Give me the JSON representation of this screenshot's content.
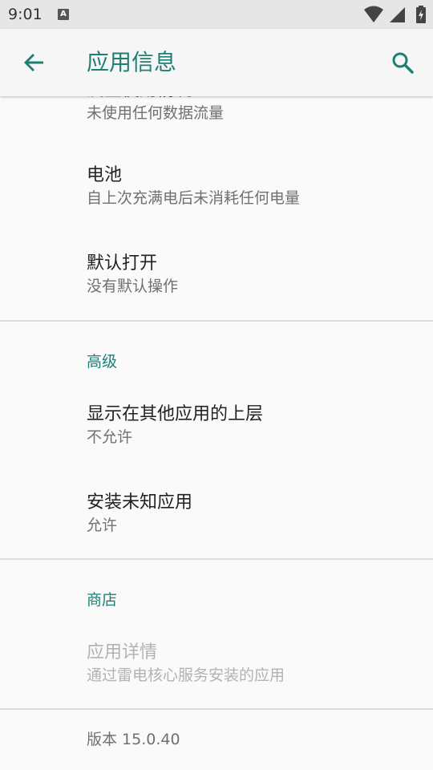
{
  "status_bar": {
    "time": "9:01",
    "notification_letter": "A"
  },
  "app_bar": {
    "title": "应用信息"
  },
  "items": {
    "data_usage": {
      "title": "流量使用情况",
      "subtitle": "未使用任何数据流量"
    },
    "battery": {
      "title": "电池",
      "subtitle": "自上次充满电后未消耗任何电量"
    },
    "open_by_default": {
      "title": "默认打开",
      "subtitle": "没有默认操作"
    },
    "advanced_header": "高级",
    "display_over": {
      "title": "显示在其他应用的上层",
      "subtitle": "不允许"
    },
    "install_unknown": {
      "title": "安装未知应用",
      "subtitle": "允许"
    },
    "store_header": "商店",
    "app_details": {
      "title": "应用详情",
      "subtitle": "通过雷电核心服务安装的应用"
    },
    "version": "版本 15.0.40"
  },
  "colors": {
    "accent": "#1f7f75",
    "status_bar": "#e6e6e6",
    "background": "#fafafa"
  }
}
